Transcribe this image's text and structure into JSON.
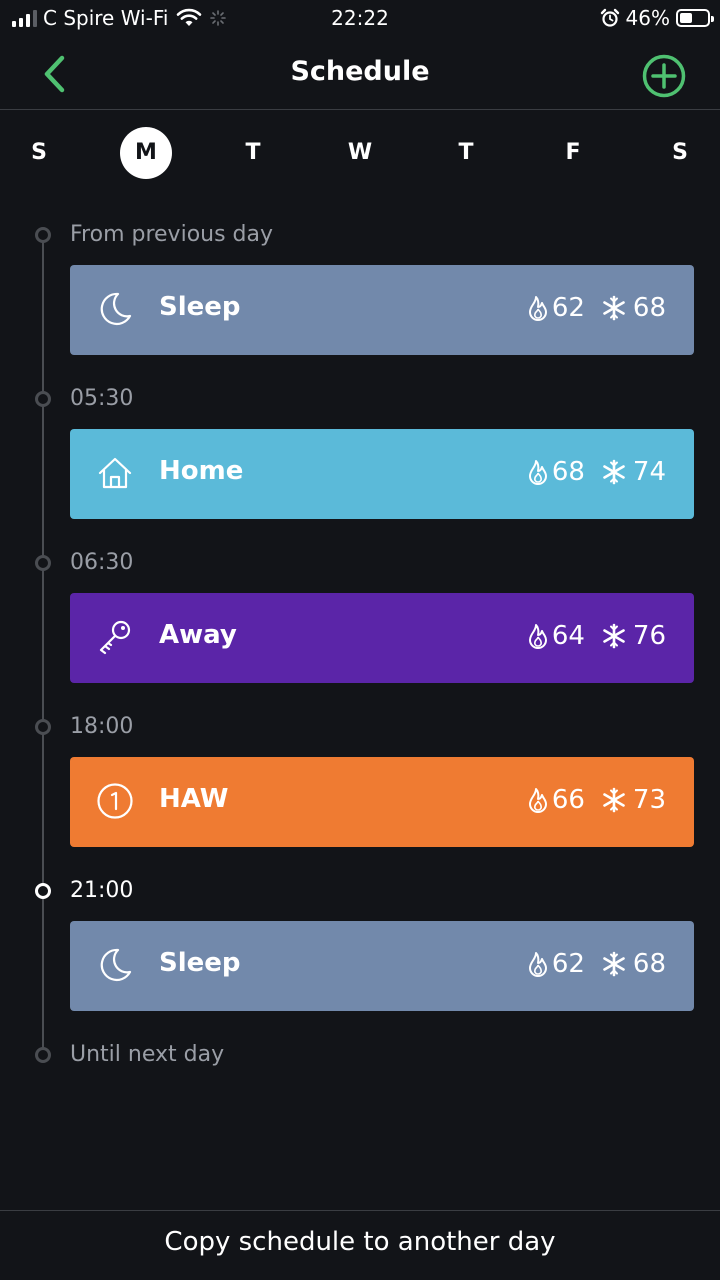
{
  "status_bar": {
    "carrier": "C Spire Wi-Fi",
    "time": "22:22",
    "battery_percent": "46%",
    "battery_level": 0.46
  },
  "header": {
    "title": "Schedule",
    "back_icon": "chevron-left-icon",
    "add_icon": "plus-circle-icon",
    "accent_color": "#4fc171"
  },
  "days": [
    {
      "label": "S",
      "selected": false
    },
    {
      "label": "M",
      "selected": true
    },
    {
      "label": "T",
      "selected": false
    },
    {
      "label": "W",
      "selected": false
    },
    {
      "label": "T",
      "selected": false
    },
    {
      "label": "F",
      "selected": false
    },
    {
      "label": "S",
      "selected": false
    }
  ],
  "timeline": {
    "start_label": "From previous day",
    "end_label": "Until next day",
    "entries": [
      {
        "time": "",
        "name": "Sleep",
        "icon": "moon-icon",
        "heat": "62",
        "cool": "68",
        "color": "#7289ab",
        "active": false
      },
      {
        "time": "05:30",
        "name": "Home",
        "icon": "house-icon",
        "heat": "68",
        "cool": "74",
        "color": "#5bbad9",
        "active": false
      },
      {
        "time": "06:30",
        "name": "Away",
        "icon": "key-icon",
        "heat": "64",
        "cool": "76",
        "color": "#5b25a8",
        "active": false
      },
      {
        "time": "18:00",
        "name": "HAW",
        "icon": "number-one-circle-icon",
        "heat": "66",
        "cool": "73",
        "color": "#ef7b32",
        "active": false
      },
      {
        "time": "21:00",
        "name": "Sleep",
        "icon": "moon-icon",
        "heat": "62",
        "cool": "68",
        "color": "#7289ab",
        "active": true
      }
    ]
  },
  "footer": {
    "copy_label": "Copy schedule to another day"
  }
}
